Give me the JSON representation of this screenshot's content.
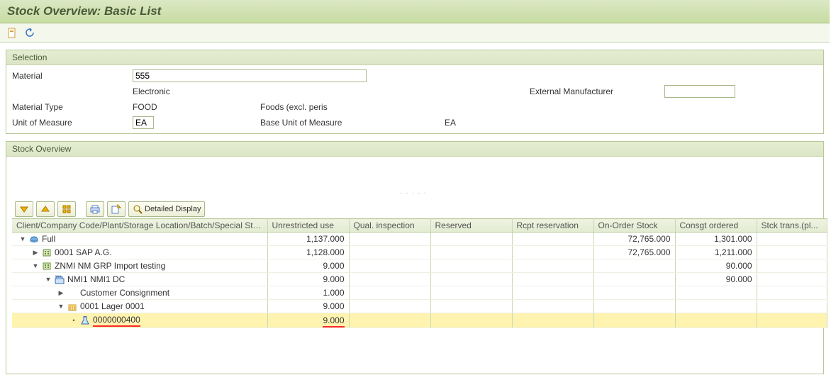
{
  "title": "Stock Overview: Basic List",
  "selection": {
    "header": "Selection",
    "material_label": "Material",
    "material_value": "555",
    "desc": "Electronic",
    "ext_manuf_label": "External Manufacturer",
    "ext_manuf_value": "",
    "type_label": "Material Type",
    "type_val": "FOOD",
    "type_desc": "Foods (excl. peris",
    "uom_label": "Unit of Measure",
    "uom_val": "EA",
    "uom_desc": "Base Unit of Measure",
    "uom_base": "EA"
  },
  "overview": {
    "header": "Stock Overview",
    "detailed_display": "Detailed Display",
    "columns": {
      "c0": "Client/Company Code/Plant/Storage Location/Batch/Special Stock",
      "c1": "Unrestricted use",
      "c2": "Qual. inspection",
      "c3": "Reserved",
      "c4": "Rcpt reservation",
      "c5": "On-Order Stock",
      "c6": "Consgt ordered",
      "c7": "Stck trans.(pl..."
    },
    "rows": [
      {
        "indent": 0,
        "toggle": "down",
        "icon": "full",
        "label": "Full",
        "v": {
          "c1": "1,137.000",
          "c5": "72,765.000",
          "c6": "1,301.000"
        }
      },
      {
        "indent": 1,
        "toggle": "right",
        "icon": "company",
        "label": "0001 SAP A.G.",
        "v": {
          "c1": "1,128.000",
          "c5": "72,765.000",
          "c6": "1,211.000"
        }
      },
      {
        "indent": 1,
        "toggle": "down",
        "icon": "company",
        "label": "ZNMI NM GRP Import testing",
        "v": {
          "c1": "9.000",
          "c6": "90.000"
        }
      },
      {
        "indent": 2,
        "toggle": "down",
        "icon": "plant",
        "label": "NMI1 NMI1 DC",
        "v": {
          "c1": "9.000",
          "c6": "90.000"
        }
      },
      {
        "indent": 3,
        "toggle": "right",
        "icon": "none",
        "label": "Customer Consignment",
        "v": {
          "c1": "1.000"
        }
      },
      {
        "indent": 3,
        "toggle": "down",
        "icon": "storage",
        "label": "0001 Lager 0001",
        "v": {
          "c1": "9.000"
        }
      },
      {
        "indent": 4,
        "toggle": "dot",
        "icon": "batch",
        "label": "0000000400",
        "selected": true,
        "v": {
          "c1": "9.000"
        }
      }
    ]
  }
}
